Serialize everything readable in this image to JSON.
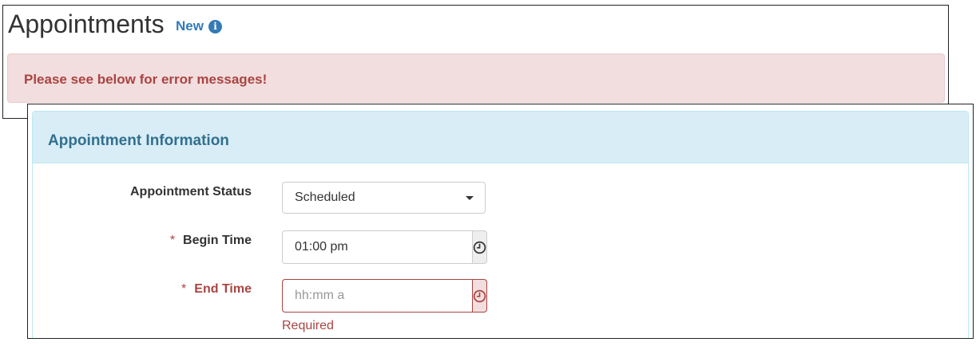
{
  "header": {
    "title": "Appointments",
    "subtitle": "New",
    "subtitle_icon": "info-circle-icon"
  },
  "alert": {
    "message": "Please see below for error messages!"
  },
  "panel": {
    "heading": "Appointment Information"
  },
  "form": {
    "status": {
      "label": "Appointment Status",
      "value": "Scheduled"
    },
    "begin_time": {
      "required_marker": "*",
      "label": "Begin Time",
      "value": "01:00 pm",
      "addon_icon": "clock-icon"
    },
    "end_time": {
      "required_marker": "*",
      "label": "End Time",
      "value": "",
      "placeholder": "hh:mm a",
      "addon_icon": "clock-icon",
      "error": "Required"
    }
  },
  "colors": {
    "link_blue": "#337ab7",
    "error_red": "#a94442",
    "alert_bg": "#f2dede",
    "panel_heading_bg": "#d9edf7",
    "panel_heading_text": "#31708f"
  }
}
